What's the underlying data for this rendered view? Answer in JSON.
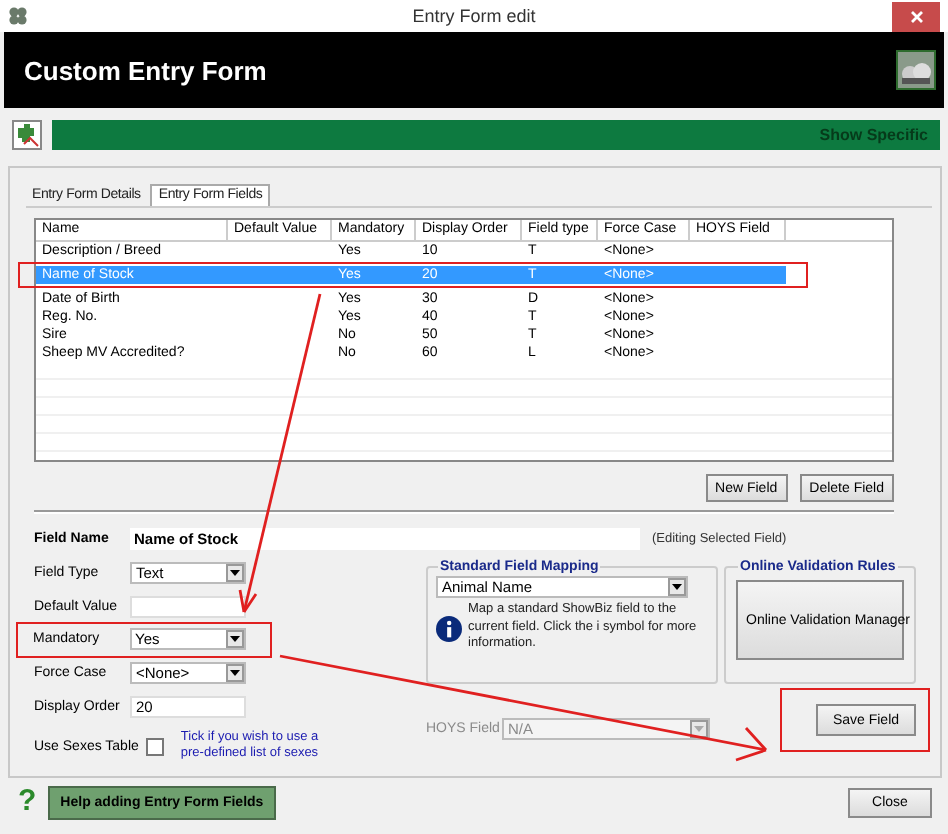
{
  "window": {
    "title": "Entry Form edit"
  },
  "header": {
    "title": "Custom Entry Form"
  },
  "banner": {
    "label": "Show Specific"
  },
  "tabs": [
    {
      "label": "Entry Form Details",
      "selected": false
    },
    {
      "label": "Entry Form Fields",
      "selected": true
    }
  ],
  "table": {
    "columns": [
      "Name",
      "Default Value",
      "Mandatory",
      "Display Order",
      "Field type",
      "Force Case",
      "HOYS Field"
    ],
    "rows": [
      {
        "cells": [
          "Description / Breed",
          "",
          "Yes",
          "10",
          "T",
          "<None>",
          ""
        ],
        "selected": false,
        "highlighted": false
      },
      {
        "cells": [
          "Name of Stock",
          "",
          "Yes",
          "20",
          "T",
          "<None>",
          ""
        ],
        "selected": true,
        "highlighted": true
      },
      {
        "cells": [
          "Date of Birth",
          "",
          "Yes",
          "30",
          "D",
          "<None>",
          ""
        ],
        "selected": false,
        "highlighted": false
      },
      {
        "cells": [
          "Reg. No.",
          "",
          "Yes",
          "40",
          "T",
          "<None>",
          ""
        ],
        "selected": false,
        "highlighted": false
      },
      {
        "cells": [
          "Sire",
          "",
          "No",
          "50",
          "T",
          "<None>",
          ""
        ],
        "selected": false,
        "highlighted": false
      },
      {
        "cells": [
          "Sheep MV Accredited?",
          "",
          "No",
          "60",
          "L",
          "<None>",
          ""
        ],
        "selected": false,
        "highlighted": false
      }
    ]
  },
  "list_buttons": [
    "New Field",
    "Delete Field"
  ],
  "form": {
    "field_name": {
      "label": "Field Name",
      "value": "Name of Stock",
      "note": "(Editing Selected Field)"
    },
    "fields": [
      {
        "kind": "select",
        "label": "Field Type",
        "value": "Text",
        "highlighted": false
      },
      {
        "kind": "input",
        "label": "Default Value",
        "highlighted": false
      },
      {
        "kind": "select",
        "label": "Mandatory",
        "value": "Yes",
        "highlighted": true
      },
      {
        "kind": "select",
        "label": "Force Case",
        "value": "<None>",
        "highlighted": false
      },
      {
        "kind": "input",
        "label": "Display Order",
        "value": "20",
        "highlighted": false
      }
    ],
    "sexes": {
      "label": "Use Sexes Table",
      "checked": false,
      "hint": "Tick if you wish to use a pre-defined list of sexes"
    }
  },
  "mapping": {
    "title": "Standard Field Mapping",
    "value": "Animal Name",
    "info": "Map a standard ShowBiz field to the current field. Click the i symbol for more information."
  },
  "hoys": {
    "label": "HOYS Field",
    "value": "N/A",
    "disabled": true
  },
  "validation": {
    "title": "Online Validation Rules",
    "button": "Online Validation Manager"
  },
  "save_button": {
    "label": "Save Field",
    "highlighted": true
  },
  "help": {
    "icon": "?",
    "button": "Help adding Entry Form Fields"
  },
  "close_button": "Close"
}
